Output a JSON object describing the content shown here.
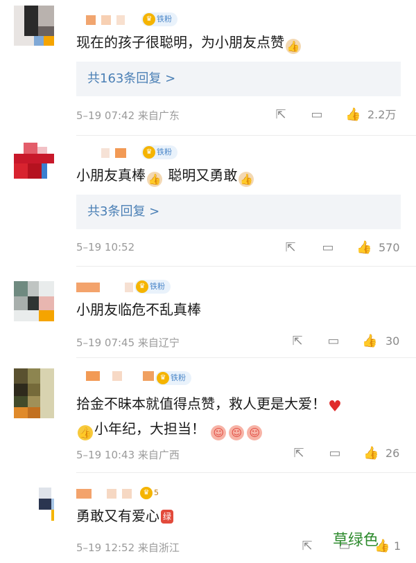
{
  "colors": {
    "link": "#4a7fb5",
    "meta": "#9a9a9a",
    "badge": "#4a86c8",
    "watermark": "#2e8b2e"
  },
  "comments": [
    {
      "badge": "铁粉",
      "text_a": "现在的孩子很聪明，为小朋友点赞",
      "replies": "共163条回复 >",
      "meta": "5–19 07:42  来自广东",
      "likes": "2.2万"
    },
    {
      "badge": "铁粉",
      "text_a": "小朋友真棒",
      "text_b": "聪明又勇敢",
      "replies": "共3条回复 >",
      "meta": "5–19 10:52",
      "likes": "570"
    },
    {
      "badge": "铁粉",
      "text_a": "小朋友临危不乱真棒",
      "meta": "5–19 07:45  来自辽宁",
      "likes": "30"
    },
    {
      "badge": "铁粉",
      "text_a": "拾金不昧本就值得点赞，救人更是大爱！",
      "text_b": "小年纪，大担当！",
      "meta": "5–19 10:43  来自广西",
      "likes": "26"
    },
    {
      "badge": "5",
      "text_a": "勇敢又有爱心",
      "red_tag": "绿",
      "meta": "5–19 12:52  来自浙江",
      "likes": "1"
    }
  ],
  "icons": {
    "share": "share-icon",
    "comment": "comment-icon",
    "like": "thumbs-up-icon"
  },
  "watermark": "草绿色"
}
